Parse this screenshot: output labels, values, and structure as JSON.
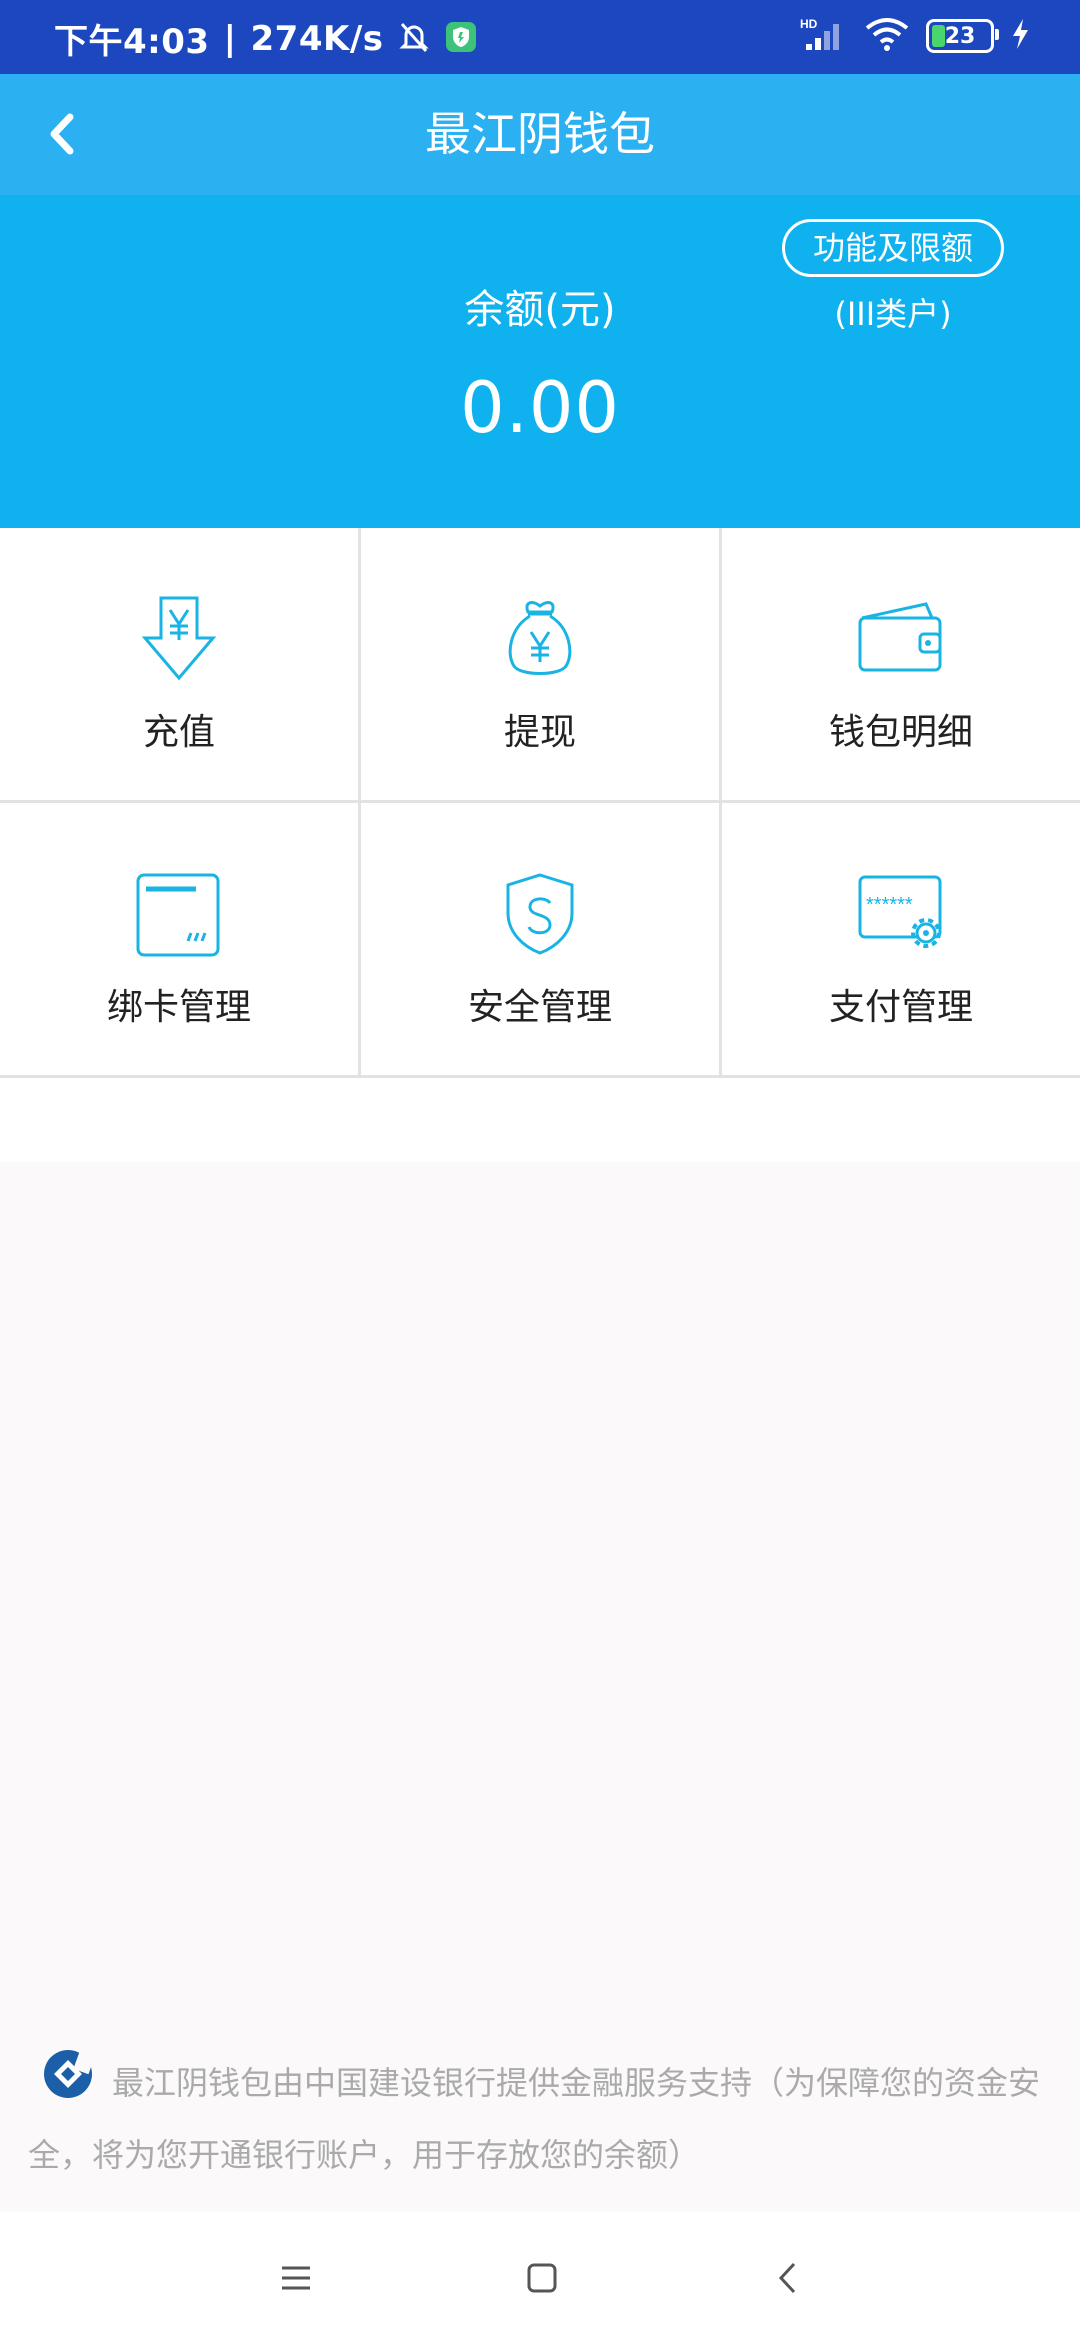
{
  "status_bar": {
    "time": "下午4:03",
    "speed": "274K/s",
    "network": "HD",
    "battery": "23",
    "battery_level": 0.23
  },
  "header": {
    "title": "最江阴钱包"
  },
  "balance": {
    "label": "余额(元)",
    "value": "0.00",
    "limits_button": "功能及限额",
    "account_type": "(III类户)"
  },
  "menu": [
    {
      "label": "充值",
      "icon": "recharge-icon"
    },
    {
      "label": "提现",
      "icon": "money-bag-icon"
    },
    {
      "label": "钱包明细",
      "icon": "wallet-icon"
    },
    {
      "label": "绑卡管理",
      "icon": "card-icon"
    },
    {
      "label": "安全管理",
      "icon": "shield-icon"
    },
    {
      "label": "支付管理",
      "icon": "payment-settings-icon"
    }
  ],
  "footer": {
    "text": "最江阴钱包由中国建设银行提供金融服务支持（为保障您的资金安全，将为您开通银行账户，用于存放您的余额）"
  },
  "colors": {
    "status_bar": "#1c47bf",
    "app_bar": "#2bb1f1",
    "balance_bg": "#0fb2ee",
    "icon": "#1ab4e4",
    "bank_logo": "#1a5fa8"
  }
}
